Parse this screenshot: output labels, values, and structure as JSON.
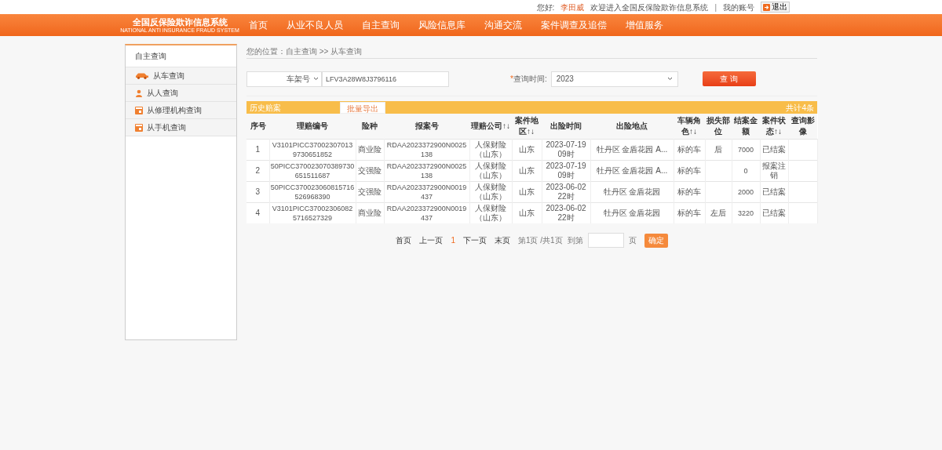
{
  "top_bar": {
    "greeting": "您好:",
    "user": "李田威",
    "welcome": "欢迎进入全国反保险欺诈信息系统",
    "separator": "|",
    "account": "我的账号",
    "logout": "退出"
  },
  "logo": {
    "title": "全国反保险欺诈信息系统",
    "subtitle": "NATIONAL ANTI INSURANCE FRAUD SYSTEM"
  },
  "nav": [
    "首页",
    "从业不良人员",
    "自主查询",
    "风险信息库",
    "沟通交流",
    "案件调查及追偿",
    "增值服务"
  ],
  "sidebar": {
    "title": "自主查询",
    "items": [
      {
        "kind": "car",
        "label": "从车查询"
      },
      {
        "kind": "person",
        "label": "从人查询"
      },
      {
        "kind": "shop",
        "label": "从修理机构查询"
      },
      {
        "kind": "shop",
        "label": "从手机查询"
      }
    ]
  },
  "breadcrumb": "您的位置：自主查询 >> 从车查询",
  "search": {
    "field_type": "车架号",
    "value": "LFV3A28W8J3796116",
    "required_mark": "*",
    "time_label": "查询时间:",
    "time_value": "2023",
    "button": "查 询"
  },
  "results": {
    "title": "历史赔案",
    "export": "批量导出",
    "total": "共计4条",
    "columns": [
      "序号",
      "理赔编号",
      "险种",
      "报案号",
      "理赔公司↑↓",
      "案件地区↑↓",
      "出险时间",
      "出险地点",
      "车辆角色↑↓",
      "损失部位",
      "结案金额",
      "案件状态↑↓",
      "查询影像"
    ],
    "rows": [
      [
        "1",
        "V3101PICC370023070139730651852",
        "商业险",
        "RDAA2023372900N0025138",
        "人保财险（山东）",
        "山东",
        "2023-07-19 09时",
        "牡丹区 金盾花园 A...",
        "标的车",
        "后",
        "7000",
        "已结案",
        ""
      ],
      [
        "2",
        "50PICC370023070389730651511687",
        "交强险",
        "RDAA2023372900N0025138",
        "人保财险（山东）",
        "山东",
        "2023-07-19 09时",
        "牡丹区 金盾花园 A...",
        "标的车",
        "",
        "0",
        "报案注销",
        ""
      ],
      [
        "3",
        "50PICC370023060815716526968390",
        "交强险",
        "RDAA2023372900N0019437",
        "人保财险（山东）",
        "山东",
        "2023-06-02 22时",
        "牡丹区 金盾花园",
        "标的车",
        "",
        "2000",
        "已结案",
        ""
      ],
      [
        "4",
        "V3101PICC370023060825716527329",
        "商业险",
        "RDAA2023372900N0019437",
        "人保财险（山东）",
        "山东",
        "2023-06-02 22时",
        "牡丹区 金盾花园",
        "标的车",
        "左后",
        "3220",
        "已结案",
        ""
      ]
    ]
  },
  "pagination": {
    "first": "首页",
    "prev": "上一页",
    "current": "1",
    "next": "下一页",
    "last": "末页",
    "info": "第1页 /共1页",
    "goto": "到第",
    "unit": "页",
    "confirm": "确定"
  }
}
